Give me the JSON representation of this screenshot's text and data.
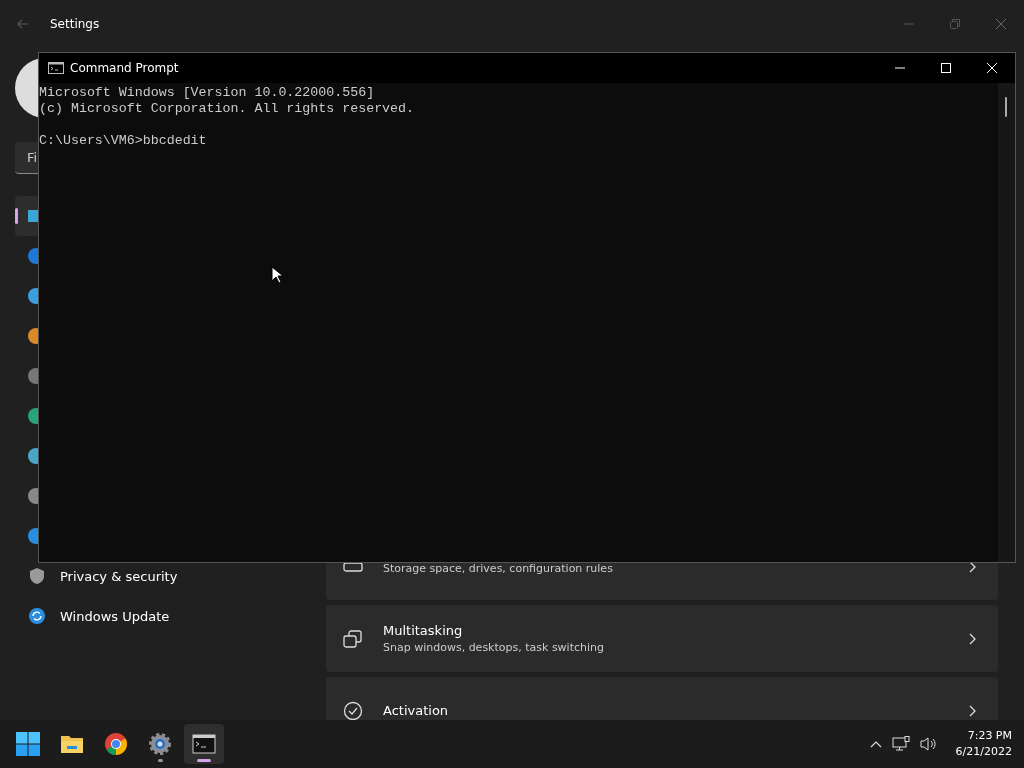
{
  "settings": {
    "title": "Settings",
    "search": {
      "value": "Fi"
    },
    "nav": [
      {
        "kind": "display",
        "selected": true
      },
      {
        "kind": "bluetooth",
        "selected": false
      },
      {
        "kind": "network",
        "selected": false
      },
      {
        "kind": "brush",
        "selected": false
      },
      {
        "kind": "apps",
        "selected": false
      },
      {
        "kind": "accounts",
        "selected": false
      },
      {
        "kind": "time",
        "selected": false
      },
      {
        "kind": "gaming",
        "selected": false
      },
      {
        "kind": "accessibility",
        "selected": false
      },
      {
        "kind": "privacy",
        "label": "Privacy & security",
        "selected": false
      },
      {
        "kind": "update",
        "label": "Windows Update",
        "selected": false
      }
    ],
    "cards": [
      {
        "kind": "storage",
        "subtitle": "Storage space, drives, configuration rules"
      },
      {
        "kind": "multitasking",
        "title": "Multitasking",
        "subtitle": "Snap windows, desktops, task switching"
      },
      {
        "kind": "activation",
        "title": "Activation"
      }
    ]
  },
  "command_prompt": {
    "title": "Command Prompt",
    "lines": [
      "Microsoft Windows [Version 10.0.22000.556]",
      "(c) Microsoft Corporation. All rights reserved."
    ],
    "prompt_line": "C:\\Users\\VM6>bbcdedit"
  },
  "taskbar": {
    "apps": [
      {
        "kind": "start",
        "selected": false
      },
      {
        "kind": "explorer",
        "selected": false
      },
      {
        "kind": "chrome",
        "selected": false
      },
      {
        "kind": "settings",
        "selected": false
      },
      {
        "kind": "terminal",
        "selected": true
      }
    ],
    "time": "7:23 PM",
    "date": "6/21/2022"
  }
}
